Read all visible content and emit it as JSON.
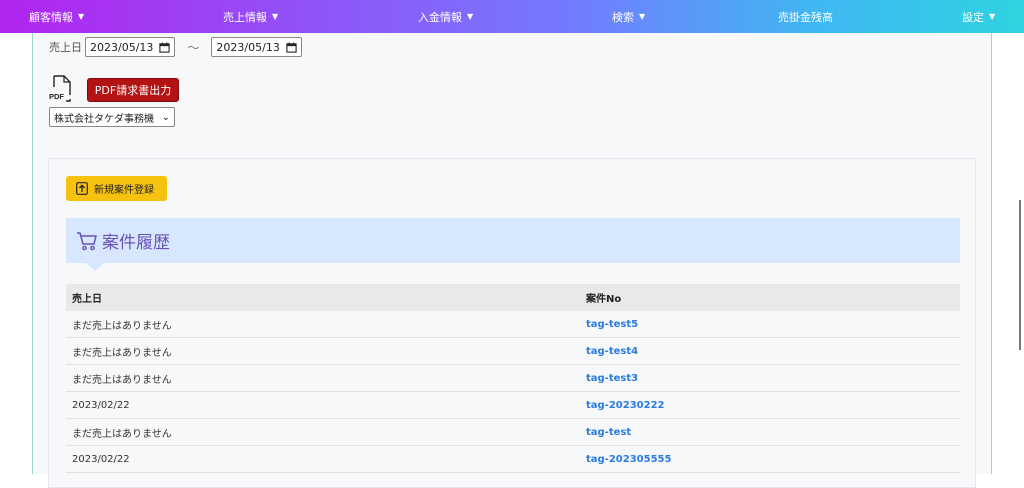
{
  "nav": {
    "items": [
      {
        "label": "顧客情報",
        "caret": "▼"
      },
      {
        "label": "売上情報",
        "caret": "▼"
      },
      {
        "label": "入金情報",
        "caret": "▼"
      },
      {
        "label": "検索",
        "caret": "▼"
      },
      {
        "label": "売掛金残高",
        "caret": ""
      },
      {
        "label": "設定",
        "caret": "▼"
      }
    ]
  },
  "filter": {
    "date_label": "売上日",
    "date_from": "2023/05/13",
    "date_to": "2023/05/13",
    "separator": "～"
  },
  "pdf": {
    "icon_text": "PDF",
    "button_label": "PDF請求書出力"
  },
  "company_select": {
    "selected": "株式会社タケダ事務機",
    "arrow": "⌄"
  },
  "new_case": {
    "label": "新規案件登録"
  },
  "history": {
    "title": "案件履歴",
    "columns": [
      "売上日",
      "案件No"
    ],
    "rows": [
      {
        "date": "まだ売上はありません",
        "case_no": "tag-test5"
      },
      {
        "date": "まだ売上はありません",
        "case_no": "tag-test4"
      },
      {
        "date": "まだ売上はありません",
        "case_no": "tag-test3"
      },
      {
        "date": "2023/02/22",
        "case_no": "tag-20230222"
      },
      {
        "date": "まだ売上はありません",
        "case_no": "tag-test"
      },
      {
        "date": "2023/02/22",
        "case_no": "tag-202305555"
      }
    ]
  },
  "colors": {
    "pdf_button": "#b41313",
    "new_button": "#f6c20f",
    "link": "#2b7be0",
    "header_bg": "#d6e7ff",
    "title": "#6a52b8"
  }
}
